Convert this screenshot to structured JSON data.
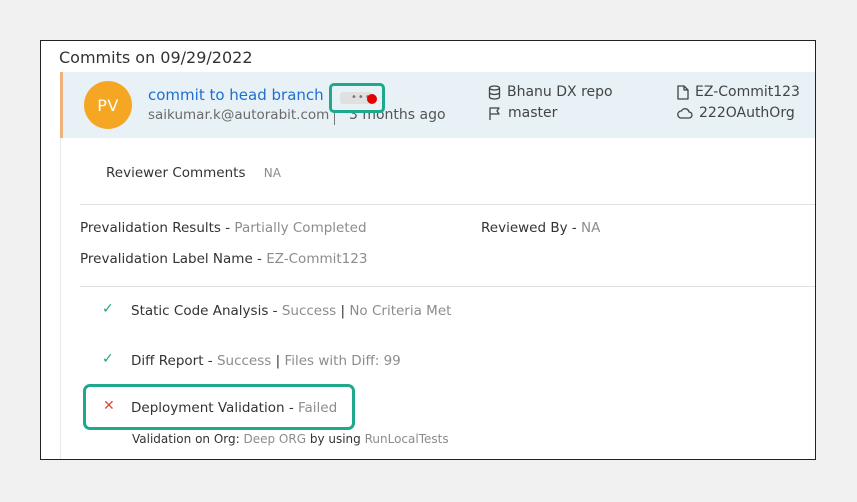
{
  "header": {
    "title": "Commits on 09/29/2022"
  },
  "commit": {
    "avatar_initials": "PV",
    "message": "commit to head branch",
    "email": "saikumar.k@autorabit.com",
    "time_ago": "3 months ago",
    "more_label": "•••",
    "repo": "Bhanu DX repo",
    "branch": "master",
    "commit_label": "EZ-Commit123",
    "org": "222OAuthOrg"
  },
  "reviewer": {
    "label": "Reviewer Comments",
    "value": "NA"
  },
  "prevalidation": {
    "results_label": "Prevalidation Results - ",
    "results_value": "Partially Completed",
    "reviewed_label": "Reviewed By - ",
    "reviewed_value": "NA",
    "label_name_label": "Prevalidation Label Name - ",
    "label_name_value": "EZ-Commit123"
  },
  "checks": {
    "static": {
      "name": "Static Code Analysis - ",
      "status": "Success",
      "detail": "No Criteria Met"
    },
    "diff": {
      "name": "Diff Report - ",
      "status": "Success",
      "detail": "Files with Diff: 99"
    },
    "deploy": {
      "name": "Deployment Validation - ",
      "status": "Failed"
    }
  },
  "validation": {
    "prefix": "Validation on Org: ",
    "org": "Deep ORG",
    "mid": " by using ",
    "tests": "RunLocalTests"
  },
  "colors": {
    "accent": "#1ea88c",
    "link": "#1f6fd1",
    "avatar": "#f5a623",
    "success": "#1fa47f",
    "fail": "#e0483a",
    "alert_dot": "#e20000"
  }
}
